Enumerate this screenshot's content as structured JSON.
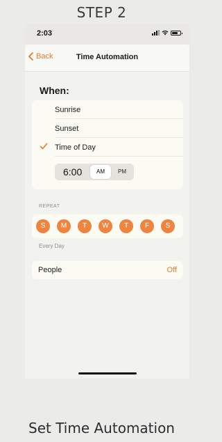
{
  "page": {
    "step_title": "STEP 2",
    "caption": "Set Time Automation"
  },
  "status_bar": {
    "time": "2:03",
    "icons": [
      "signal-icon",
      "wifi-icon",
      "battery-icon"
    ]
  },
  "nav": {
    "back_label": "Back",
    "title": "Time Automation"
  },
  "when": {
    "heading": "When:",
    "options": [
      {
        "label": "Sunrise",
        "selected": false
      },
      {
        "label": "Sunset",
        "selected": false
      },
      {
        "label": "Time of Day",
        "selected": true
      }
    ],
    "time_value": "6:00",
    "am_label": "AM",
    "pm_label": "PM",
    "period_selected": "AM"
  },
  "repeat": {
    "label": "REPEAT",
    "days": [
      "S",
      "M",
      "T",
      "W",
      "T",
      "F",
      "S"
    ],
    "summary": "Every Day"
  },
  "people": {
    "label": "People",
    "value": "Off"
  },
  "colors": {
    "accent": "#e27b2e",
    "day_circle": "#ed8540",
    "background": "#ebebea"
  }
}
